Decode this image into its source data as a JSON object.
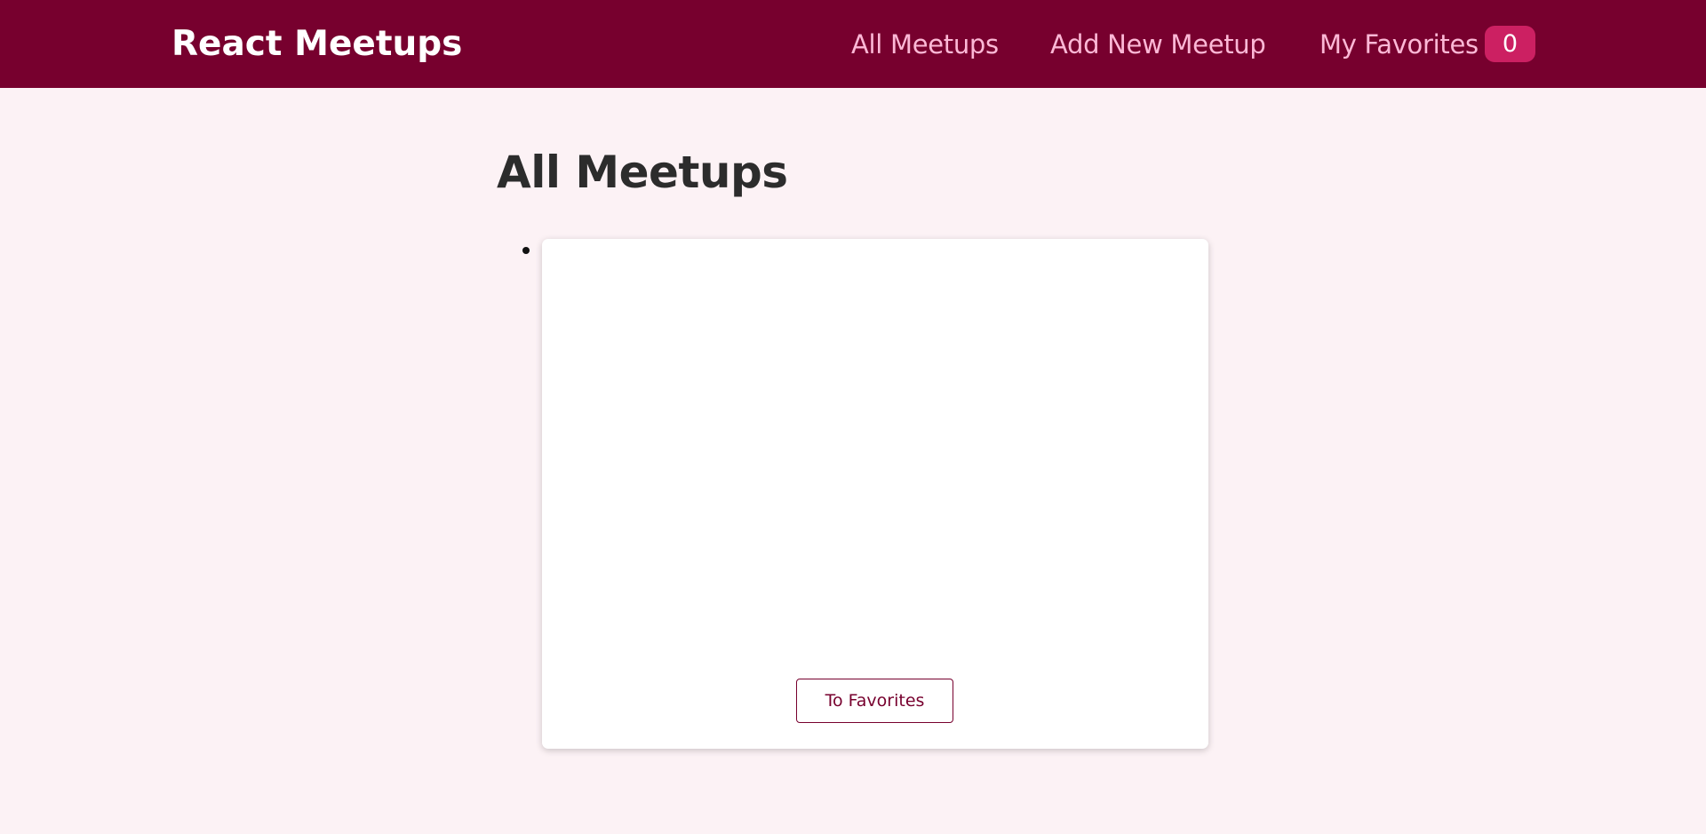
{
  "header": {
    "logo": "React Meetups",
    "nav": {
      "all_meetups": "All Meetups",
      "add_new_meetup": "Add New Meetup",
      "my_favorites": "My Favorites",
      "favorites_count": "0"
    }
  },
  "main": {
    "title": "All Meetups",
    "meetups": [
      {
        "favorite_button_label": "To Favorites"
      }
    ]
  },
  "colors": {
    "header_bg": "#77002e",
    "page_bg": "#fcf2f5",
    "nav_text": "#fcb8d6",
    "badge_bg": "#cc2062",
    "button_accent": "#77002e"
  }
}
